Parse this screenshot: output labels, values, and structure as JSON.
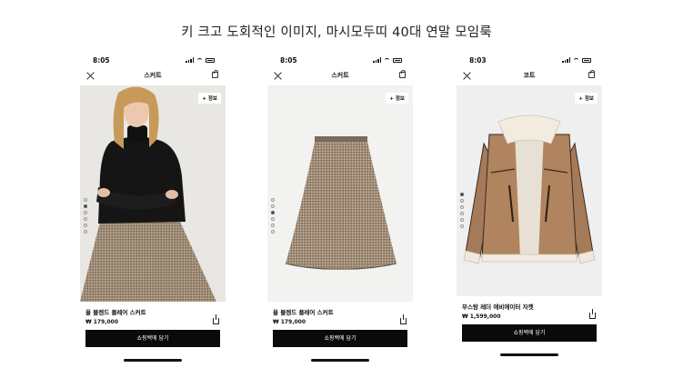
{
  "headline": "키 크고 도회적인 이미지, 마시모두띠 40대 연말 모임룩",
  "phones": [
    {
      "time": "8:05",
      "nav_title": "스커트",
      "info_label": "+ 정보",
      "product_name": "울 블렌드 플레어 스커트",
      "price": "₩ 179,000",
      "cta": "쇼핑백에 담기",
      "image": "model wearing black turtleneck and tweed flared skirt",
      "dots_total": 6,
      "dots_active": 2
    },
    {
      "time": "8:05",
      "nav_title": "스커트",
      "info_label": "+ 정보",
      "product_name": "울 블렌드 플레어 스커트",
      "price": "₩ 179,000",
      "cta": "쇼핑백에 담기",
      "image": "tweed flared midi skirt",
      "dots_total": 6,
      "dots_active": 3
    },
    {
      "time": "8:03",
      "nav_title": "코트",
      "info_label": "+ 정보",
      "product_name": "무스탕 레더 에비에이터 자켓",
      "price": "₩ 1,599,000",
      "cta": "쇼핑백에 담기",
      "image": "brown suede aviator shearling jacket",
      "dots_total": 6,
      "dots_active": 1
    }
  ],
  "colors": {
    "cta_bg": "#0a0a0a",
    "photo_bg_1": "#e9e7e3",
    "photo_bg_2": "#f2f2f0",
    "photo_bg_3": "#efefef"
  }
}
